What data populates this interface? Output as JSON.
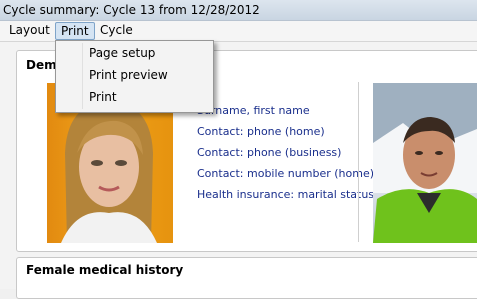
{
  "window": {
    "title": "Cycle summary: Cycle 13 from 12/28/2012"
  },
  "menu": {
    "layout": "Layout",
    "print": "Print",
    "cycle": "Cycle"
  },
  "print_menu": {
    "items": [
      "Page setup",
      "Print preview",
      "Print"
    ]
  },
  "demographics": {
    "title_visible": "Demo",
    "partial_field": "e",
    "fields": [
      "Surname, first name",
      "Contact: phone (home)",
      "Contact: phone (business)",
      "Contact: mobile number (home)",
      "Health insurance: marital status"
    ]
  },
  "history": {
    "title": "Female medical history"
  }
}
